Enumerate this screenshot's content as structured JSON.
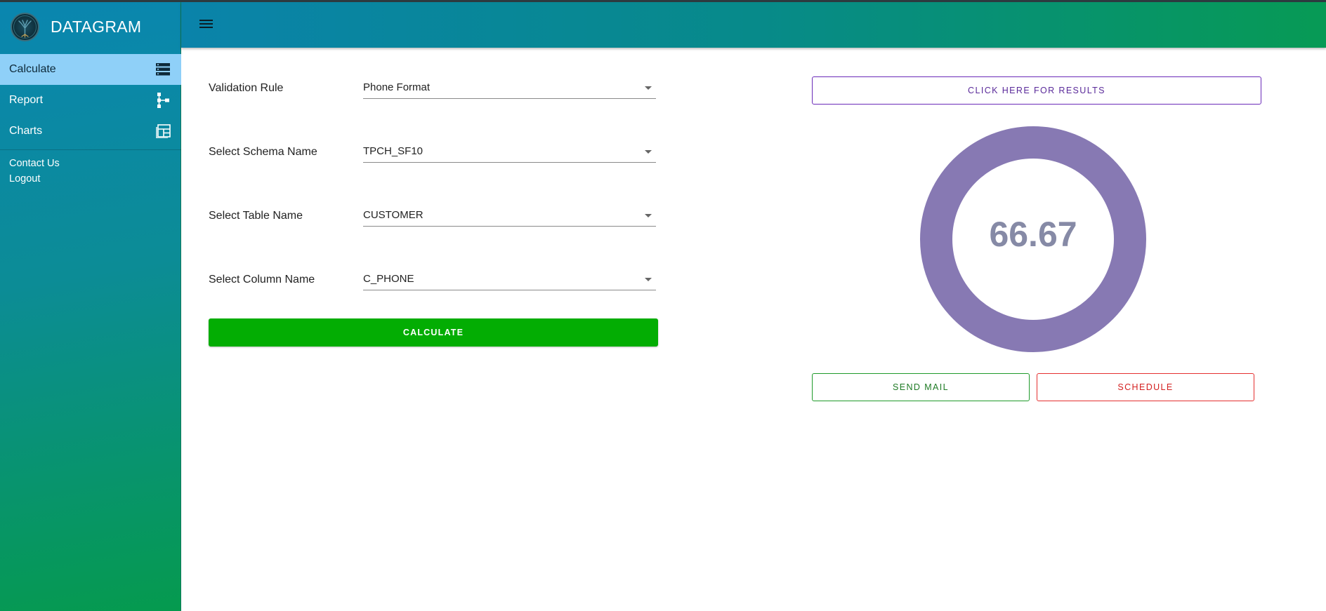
{
  "app": {
    "title": "DATAGRAM",
    "logo_icon": "tree-circle-logo"
  },
  "sidebar": {
    "items": [
      {
        "label": "Calculate",
        "icon": "server-stack-icon",
        "active": true
      },
      {
        "label": "Report",
        "icon": "hierarchy-icon",
        "active": false
      },
      {
        "label": "Charts",
        "icon": "dashboard-layout-icon",
        "active": false
      }
    ],
    "links": [
      "Contact Us",
      "Logout"
    ]
  },
  "topbar": {
    "menu_icon": "hamburger-menu-icon"
  },
  "form": {
    "fields": [
      {
        "label": "Validation Rule",
        "value": "Phone Format"
      },
      {
        "label": "Select Schema Name",
        "value": "TPCH_SF10"
      },
      {
        "label": "Select Table Name",
        "value": "CUSTOMER"
      },
      {
        "label": "Select Column Name",
        "value": "C_PHONE"
      }
    ],
    "calculate_label": "CALCULATE"
  },
  "results": {
    "button_label": "CLICK HERE FOR RESULTS",
    "score": "66.67",
    "send_mail_label": "SEND MAIL",
    "schedule_label": "SCHEDULE"
  },
  "colors": {
    "active_nav": "#8fd0f8",
    "calculate_button": "#03ad03",
    "gauge_ring": "#8779b3",
    "results_border": "#6a2ab8",
    "mail_border": "#1f9a2a",
    "schedule_border": "#e53030"
  }
}
